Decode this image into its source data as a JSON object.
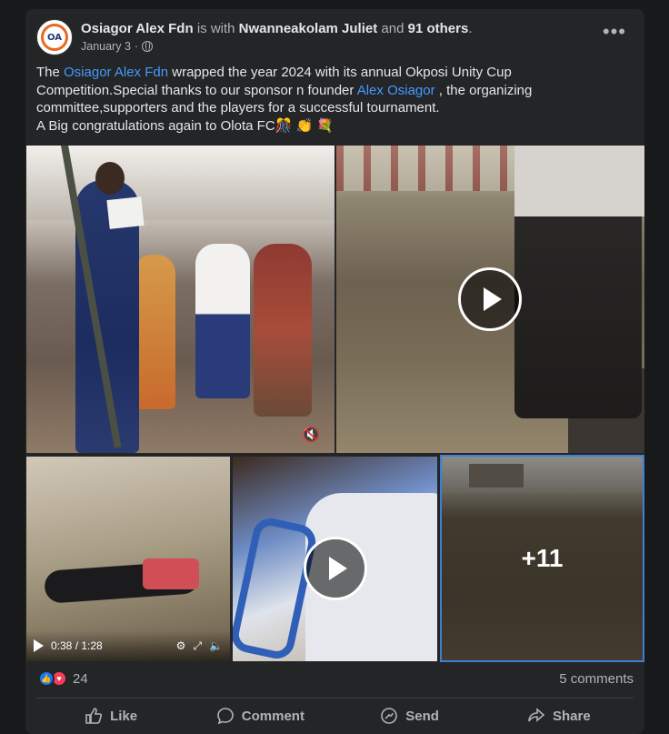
{
  "post": {
    "author": "Osiagor Alex Fdn",
    "with_word": "is with",
    "tagged": "Nwanneakolam Juliet",
    "and_word": "and",
    "others": "91 others",
    "period": ".",
    "date": "January 3",
    "dot": "·",
    "more": "•••",
    "avatar_text": "OA",
    "text": {
      "p1": "The ",
      "link1": "Osiagor Alex Fdn",
      "p2": " wrapped the year 2024 with its annual Okposi Unity Cup Competition.Special thanks to our sponsor n founder ",
      "link2": "Alex Osiagor",
      "p3": " , the organizing committee,supporters and the players for a successful tournament.",
      "line2": "A Big congratulations again to Olota FC🎊 👏 💐"
    }
  },
  "media": {
    "video_time": "0:38 / 1:28",
    "more_count": "+11"
  },
  "footer": {
    "reaction_count": "24",
    "comments": "5 comments",
    "like": "Like",
    "comment": "Comment",
    "send": "Send",
    "share": "Share"
  },
  "colors": {
    "link": "#4599ff",
    "bg": "#242526",
    "accent": "#1877f2"
  },
  "icons": [
    "globe-icon",
    "more-icon",
    "play-icon",
    "mute-icon",
    "settings-icon",
    "fullscreen-icon",
    "volume-icon",
    "like-icon",
    "comment-icon",
    "send-icon",
    "share-icon"
  ]
}
